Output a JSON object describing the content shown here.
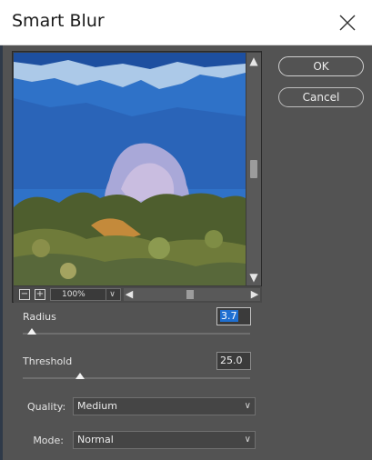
{
  "window": {
    "title": "Smart Blur"
  },
  "preview": {
    "zoom": "100%"
  },
  "buttons": {
    "ok": "OK",
    "cancel": "Cancel"
  },
  "radius": {
    "label": "Radius",
    "value": "3.7",
    "level": 0.04
  },
  "threshold": {
    "label": "Threshold",
    "value": "25.0",
    "level": 0.25
  },
  "quality": {
    "label": "Quality:",
    "selected": "Medium"
  },
  "mode": {
    "label": "Mode:",
    "selected": "Normal"
  },
  "icons": {
    "close": "close-icon",
    "zoom_out": "zoom-out-icon",
    "zoom_in": "zoom-in-icon",
    "chevron": "chevron-down-icon"
  },
  "colors": {
    "accent": "#1e6fd1",
    "dialog_bg": "#535353",
    "titlebar_bg": "#ffffff"
  }
}
